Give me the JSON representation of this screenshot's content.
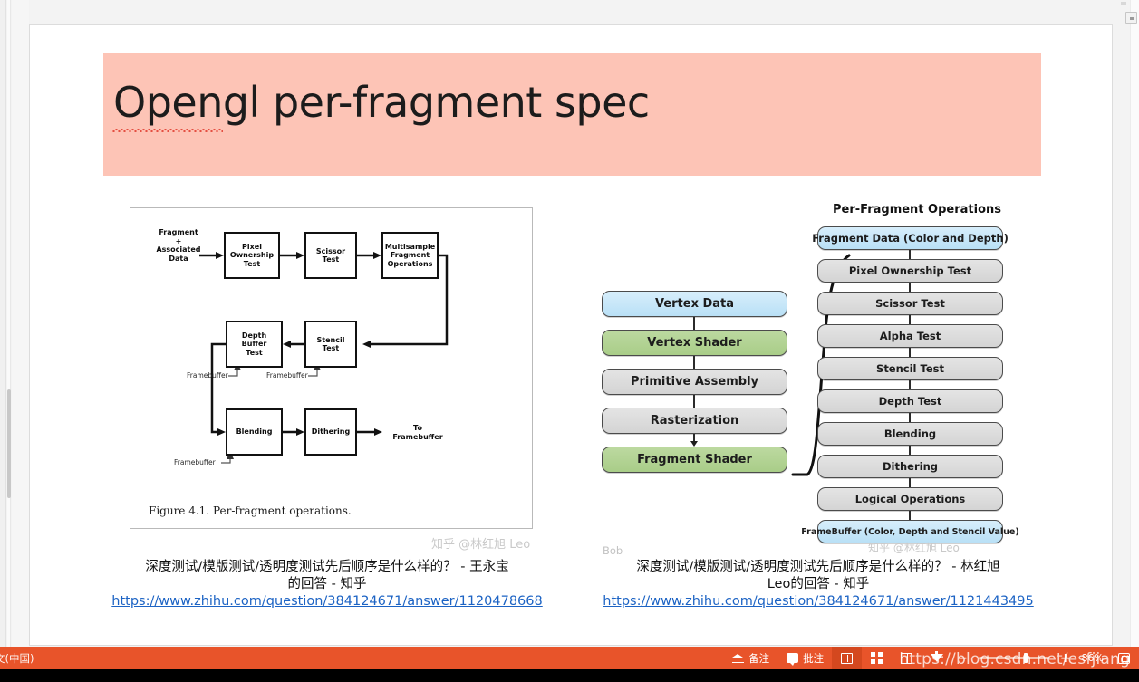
{
  "app": {
    "zoom_level": "86%",
    "language_indicator": "文(中国)",
    "url_watermark": "https://blog.csdn.net/esfjiang"
  },
  "slide": {
    "title": "Opengl per-fragment spec"
  },
  "left_figure": {
    "caption": "Figure 4.1. Per-fragment operations.",
    "input_label": "Fragment\n+\nAssociated\nData",
    "output_label": "To\nFramebuffer",
    "boxes": [
      {
        "label": "Pixel Ownership Test"
      },
      {
        "label": "Scissor Test"
      },
      {
        "label": "Multisample Fragment Operations"
      },
      {
        "label": "Stencil Test"
      },
      {
        "label": "Depth Buffer Test"
      },
      {
        "label": "Blending"
      },
      {
        "label": "Dithering"
      }
    ],
    "framebuffer_labels": [
      "Framebuffer",
      "Framebuffer",
      "Framebuffer"
    ],
    "watermark": "知乎 @林红旭 Leo"
  },
  "middle_figure": {
    "author_tag": "Bob",
    "stages": [
      {
        "label": "Vertex Data",
        "color": "blue"
      },
      {
        "label": "Vertex Shader",
        "color": "green"
      },
      {
        "label": "Primitive Assembly",
        "color": "grey"
      },
      {
        "label": "Rasterization",
        "color": "grey"
      },
      {
        "label": "Fragment Shader",
        "color": "green"
      }
    ]
  },
  "right_figure": {
    "title": "Per-Fragment Operations",
    "stages": [
      {
        "label": "Fragment Data (Color and Depth)",
        "color": "blue"
      },
      {
        "label": "Pixel Ownership Test",
        "color": "grey"
      },
      {
        "label": "Scissor Test",
        "color": "grey"
      },
      {
        "label": "Alpha Test",
        "color": "grey"
      },
      {
        "label": "Stencil Test",
        "color": "grey"
      },
      {
        "label": "Depth Test",
        "color": "grey"
      },
      {
        "label": "Blending",
        "color": "grey"
      },
      {
        "label": "Dithering",
        "color": "grey"
      },
      {
        "label": "Logical Operations",
        "color": "grey"
      },
      {
        "label": "FrameBuffer (Color, Depth and Stencil Value)",
        "color": "blue"
      }
    ],
    "watermark": "知乎 @林红旭 Leo"
  },
  "captions": {
    "left": {
      "line1": "深度测试/模版测试/透明度测试先后顺序是什么样的？ - 王永宝",
      "line2": "的回答 - 知乎",
      "link": "https://www.zhihu.com/question/384124671/answer/1120478668"
    },
    "right": {
      "line1": "深度测试/模版测试/透明度测试先后顺序是什么样的？ - 林红旭",
      "line2": "Leo的回答 - 知乎",
      "link": "https://www.zhihu.com/question/384124671/answer/1121443495"
    }
  },
  "statusbar": {
    "notes_label": "备注",
    "comments_label": "批注",
    "view_normal": "normal-view",
    "view_sorter": "slide-sorter-view",
    "view_reading": "reading-view",
    "view_show": "slide-show-view",
    "zoom_out": "−",
    "zoom_in": "+",
    "fit_label": "fit-to-window"
  },
  "colors": {
    "banner": "#fdc4b6",
    "statusbar": "#e8542a",
    "link": "#1c63c4",
    "pipe_blue": "#b9e0f6",
    "pipe_green": "#a9cd88",
    "pipe_grey": "#d4d4d4"
  }
}
